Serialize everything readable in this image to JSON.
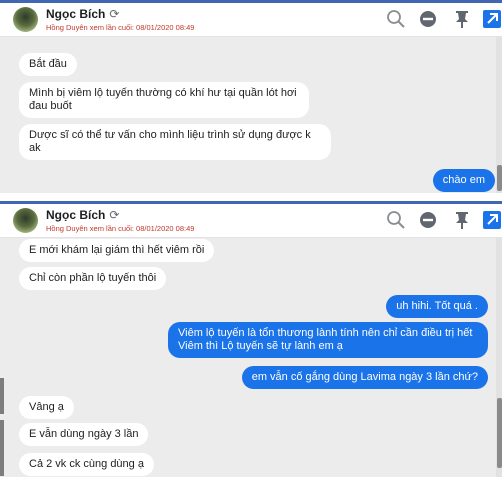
{
  "colors": {
    "accent": "#1a73e8",
    "header_bar": "#4267b2",
    "last_seen": "#c0392b",
    "chat_bg": "#ececec"
  },
  "icons": [
    "sync-icon",
    "search-icon",
    "block-icon",
    "pin-icon",
    "expand-icon"
  ],
  "panel1": {
    "contact_name": "Ngọc Bích",
    "last_seen": "Hồng Duyên xem lần cuối: 08/01/2020 08:49",
    "messages": [
      {
        "dir": "in",
        "text": "Bắt đầu"
      },
      {
        "dir": "in",
        "text": "Mình bị viêm lộ tuyến thường có khí hư tại quần lót hơi đau buốt"
      },
      {
        "dir": "in",
        "text": "Dược sĩ có thể tư vấn cho mình liệu trình sử dụng được k ak"
      },
      {
        "dir": "out",
        "text": "chào em"
      }
    ]
  },
  "panel2": {
    "contact_name": "Ngọc Bích",
    "last_seen": "Hồng Duyên xem lần cuối: 08/01/2020 08:49",
    "messages": [
      {
        "dir": "in",
        "text": "E mới khám lại giám thì hết viêm rồi"
      },
      {
        "dir": "in",
        "text": "Chỉ còn phần lộ tuyến thôi"
      },
      {
        "dir": "out",
        "text": "uh hihi. Tốt quá ."
      },
      {
        "dir": "out",
        "text": "Viêm lộ tuyến là tổn thương lành tính nên chỉ cần điều trị hết Viêm  thì Lộ tuyến sẽ tự lành em ạ"
      },
      {
        "dir": "out",
        "text": "em vẫn cố gắng dùng Lavima ngày 3 lần chứ?"
      },
      {
        "dir": "in",
        "text": "Vâng ạ"
      },
      {
        "dir": "in",
        "text": "E vẫn dùng ngày 3 lần"
      },
      {
        "dir": "in",
        "text": "Cả 2 vk ck cùng dùng ạ"
      }
    ]
  }
}
